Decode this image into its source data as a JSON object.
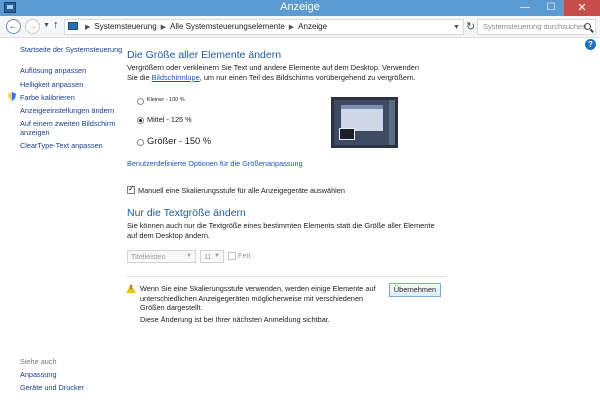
{
  "window": {
    "title": "Anzeige",
    "controls": {
      "minimize": "—",
      "maximize": "☐",
      "close": "✕"
    }
  },
  "address": {
    "crumbs": [
      "Systemsteuerung",
      "Alle Systemsteuerungselemente",
      "Anzeige"
    ],
    "search_placeholder": "Systemsteuerung durchsuchen"
  },
  "sidebar": {
    "home": "Startseite der Systemsteuerung",
    "items": [
      "Auflösung anpassen",
      "Helligkeit anpassen",
      "Farbe kalibrieren",
      "Anzeigeeinstellungen ändern",
      "Auf einem zweiten Bildschirm anzeigen",
      "ClearType-Text anpassen"
    ],
    "see_also_label": "Siehe auch",
    "see_also": [
      "Anpassung",
      "Geräte und Drucker"
    ]
  },
  "main": {
    "heading": "Die Größe aller Elemente ändern",
    "desc_before": "Vergrößern oder verkleinern Sie Text und andere Elemente auf dem Desktop. Verwenden Sie die ",
    "desc_link": "Bildschirmlupe",
    "desc_after": ", um nur einen Teil des Bildschirms vorübergehend zu vergrößern.",
    "options": [
      {
        "label": "Kleiner - 100 %",
        "selected": false
      },
      {
        "label": "Mittel - 125 %",
        "selected": true
      },
      {
        "label": "Größer - 150 %",
        "selected": false
      }
    ],
    "custom_link": "Benutzerdefinierte Optionen für die Größenanpassung",
    "manual_scaling_label": "Manuell eine Skalierungsstufe für alle Anzeigegeräte auswählen",
    "manual_scaling_checked": true,
    "text_heading": "Nur die Textgröße ändern",
    "text_desc": "Sie können auch nur die Textgröße eines bestimmten Elements statt die Größe aller Elemente auf dem Desktop ändern.",
    "element_select": "Titelleisten",
    "size_select": "11",
    "bold_label": "Fett",
    "bold_checked": false,
    "warning": "Wenn Sie eine Skalierungsstufe verwenden, werden einige Elemente auf unterschiedlichen Anzeigegeräten möglicherweise mit verschiedenen Größen dargestellt.",
    "info": "Diese Änderung ist bei Ihrer nächsten Anmeldung sichtbar.",
    "apply_label": "Übernehmen"
  }
}
